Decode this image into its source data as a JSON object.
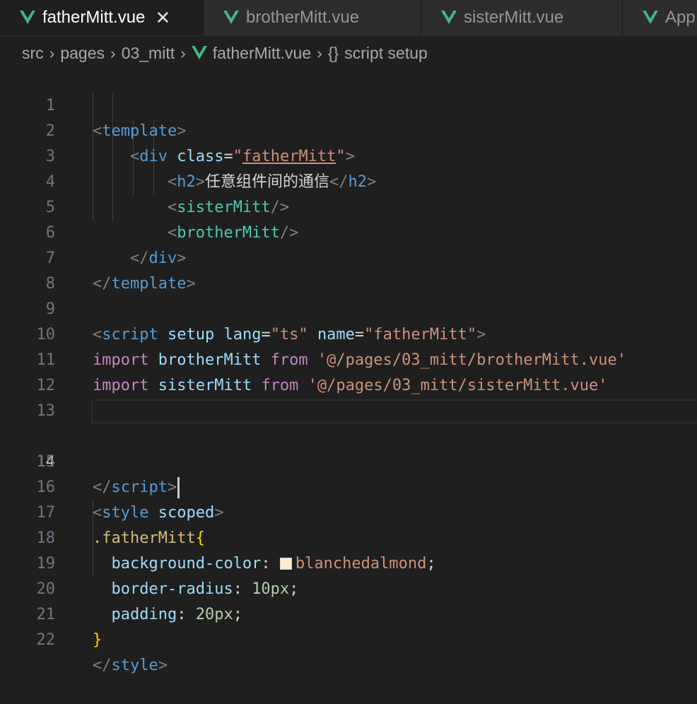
{
  "tabs": [
    {
      "label": "fatherMitt.vue",
      "active": true
    },
    {
      "label": "brotherMitt.vue",
      "active": false
    },
    {
      "label": "sisterMitt.vue",
      "active": false
    },
    {
      "label": "App",
      "active": false
    }
  ],
  "breadcrumb": {
    "parts": [
      "src",
      "pages",
      "03_mitt"
    ],
    "file": "fatherMitt.vue",
    "symbol": "script setup"
  },
  "editor": {
    "current_line": 14,
    "line_numbers": [
      "1",
      "2",
      "3",
      "4",
      "5",
      "6",
      "7",
      "8",
      "9",
      "10",
      "11",
      "12",
      "13",
      "14",
      "15",
      "16",
      "17",
      "18",
      "19",
      "20",
      "21",
      "22"
    ],
    "swatch_color": "#ffebcd",
    "code": {
      "l1": {
        "open": "<",
        "tag": "template",
        "close": ">"
      },
      "l2": {
        "open": "<",
        "tag": "div",
        "attr": "class",
        "eq": "=",
        "q1": "\"",
        "val": "fatherMitt",
        "q2": "\"",
        "close": ">"
      },
      "l3": {
        "open": "<",
        "tag": "h2",
        "close": ">",
        "text": "任意组件间的通信",
        "endopen": "</",
        "endtag": "h2",
        "endclose": ">"
      },
      "l4": {
        "open": "<",
        "comp": "sisterMitt",
        "close": "/>"
      },
      "l5": {
        "open": "<",
        "comp": "brotherMitt",
        "close": "/>"
      },
      "l6": {
        "open": "</",
        "tag": "div",
        "close": ">"
      },
      "l7": {
        "open": "</",
        "tag": "template",
        "close": ">"
      },
      "l9": {
        "open": "<",
        "tag": "script",
        "a1": "setup",
        "a2": "lang",
        "eq": "=",
        "v2": "\"ts\"",
        "a3": "name",
        "v3": "\"fatherMitt\"",
        "close": ">"
      },
      "l10": {
        "kw1": "import",
        "id": "brotherMitt",
        "kw2": "from",
        "path": "'@/pages/03_mitt/brotherMitt.vue'"
      },
      "l11": {
        "kw1": "import",
        "id": "sisterMitt",
        "kw2": "from",
        "path": "'@/pages/03_mitt/sisterMitt.vue'"
      },
      "l14": {
        "open": "</",
        "tag": "script",
        "close": ">"
      },
      "l16": {
        "open": "<",
        "tag": "style",
        "a1": "scoped",
        "close": ">"
      },
      "l17": {
        "sel": ".fatherMitt",
        "brace": "{"
      },
      "l18": {
        "prop": "background-color",
        "colon": ":",
        "val": "blanchedalmond",
        "semi": ";"
      },
      "l19": {
        "prop": "border-radius",
        "colon": ":",
        "val": "10px",
        "semi": ";"
      },
      "l20": {
        "prop": "padding",
        "colon": ":",
        "val": "20px",
        "semi": ";"
      },
      "l21": {
        "brace": "}"
      },
      "l22": {
        "open": "</",
        "tag": "style",
        "close": ">"
      }
    }
  }
}
